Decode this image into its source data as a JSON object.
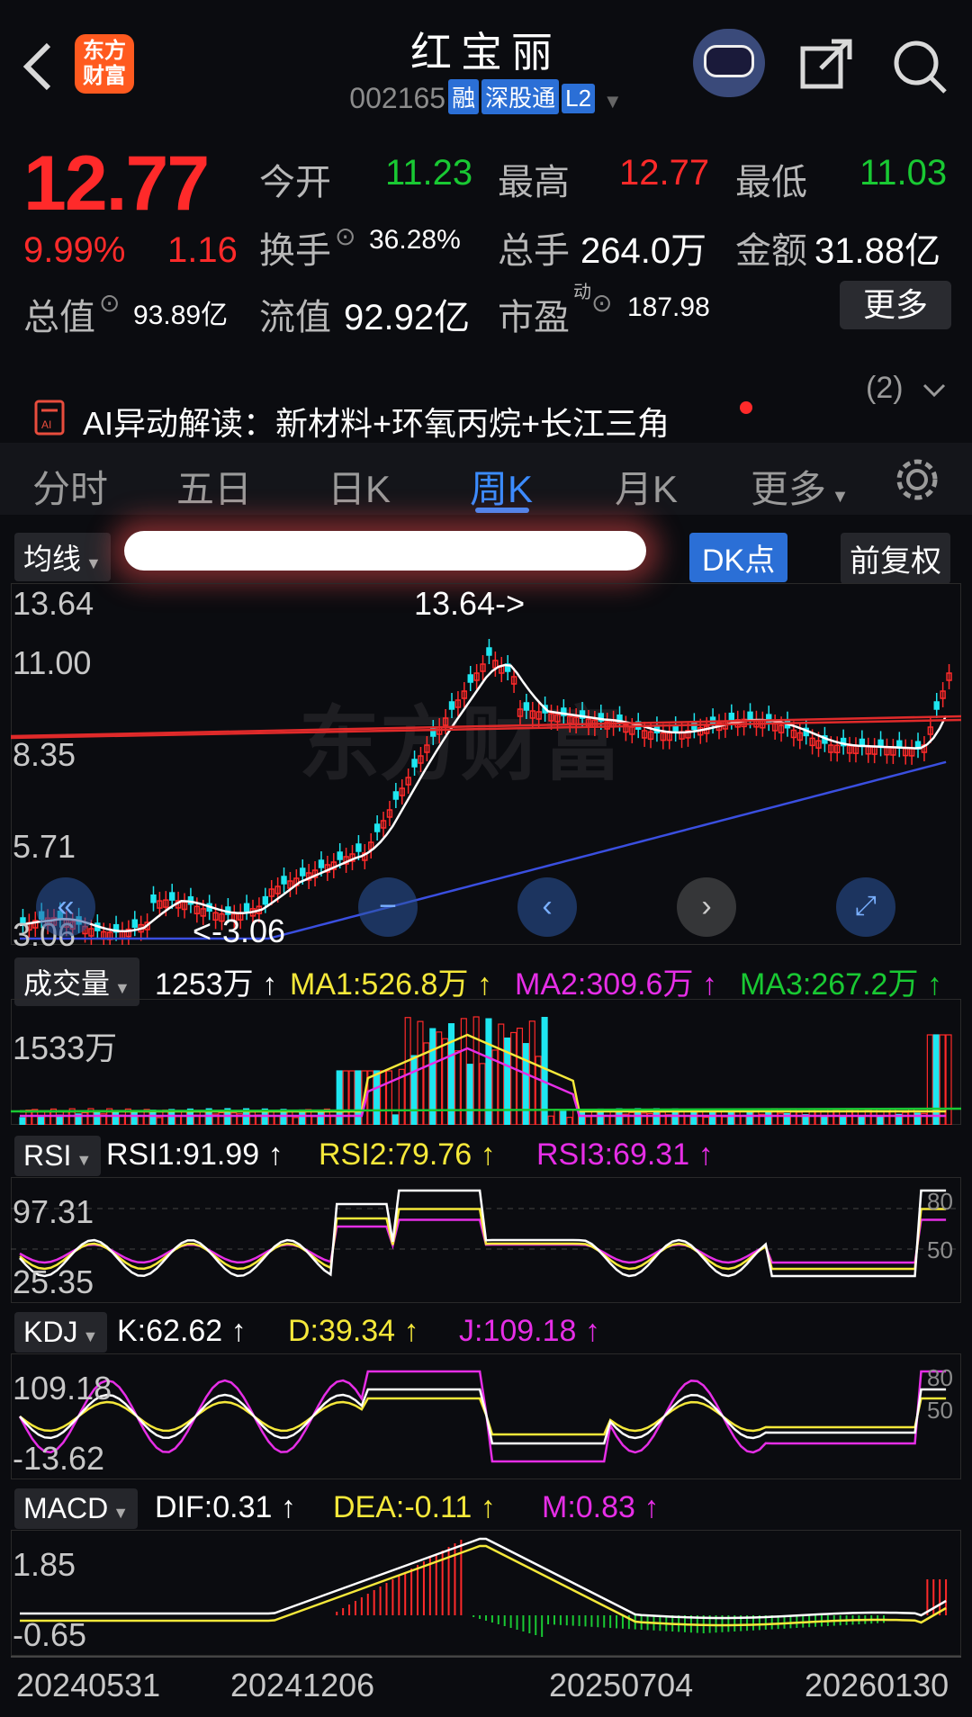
{
  "header": {
    "title": "红宝丽",
    "code": "002165",
    "tags": [
      "融",
      "深股通",
      "L2"
    ],
    "logo_lines": [
      "东方",
      "财富"
    ]
  },
  "quote": {
    "price": "12.77",
    "pct": "9.99%",
    "change": "1.16",
    "stats": {
      "open_label": "今开",
      "open": "11.23",
      "high_label": "最高",
      "high": "12.77",
      "low_label": "最低",
      "low": "11.03",
      "turnover_label": "换手",
      "turnover": "36.28%",
      "volume_label": "总手",
      "volume": "264.0万",
      "amount_label": "金额",
      "amount": "31.88亿",
      "mcap_label": "总值",
      "mcap": "93.89亿",
      "float_label": "流值",
      "float": "92.92亿",
      "pe_label": "市盈",
      "pe_sup": "动",
      "pe": "187.98"
    },
    "more_button": "更多"
  },
  "ai": {
    "text": "AI异动解读：新材料+环氧丙烷+长江三角",
    "count": "(2)"
  },
  "tabs": [
    "分时",
    "五日",
    "日K",
    "周K",
    "月K",
    "更多"
  ],
  "toolbar": {
    "ma_label": "均线",
    "dk_label": "DK点",
    "adjust_label": "前复权"
  },
  "kline": {
    "y_labels": [
      "13.64",
      "11.00",
      "8.35",
      "5.71",
      "3.06"
    ],
    "max_marker": "13.64->",
    "min_marker": "<-3.06",
    "watermark": "东方财富"
  },
  "volume": {
    "chip": "成交量",
    "current": "1253万 ↑",
    "ma1": "MA1:526.8万 ↑",
    "ma2": "MA2:309.6万 ↑",
    "ma3": "MA3:267.2万 ↑",
    "y_label": "1533万"
  },
  "rsi": {
    "chip": "RSI",
    "rsi1": "RSI1:91.99 ↑",
    "rsi2": "RSI2:79.76 ↑",
    "rsi3": "RSI3:69.31 ↑",
    "y_top": "97.31",
    "y_bottom": "25.35",
    "r80": "80",
    "r50": "50"
  },
  "kdj": {
    "chip": "KDJ",
    "k": "K:62.62 ↑",
    "d": "D:39.34 ↑",
    "j": "J:109.18 ↑",
    "y_top": "109.18",
    "y_bottom": "-13.62",
    "r80": "80",
    "r50": "50"
  },
  "macd": {
    "chip": "MACD",
    "dif": "DIF:0.31 ↑",
    "dea": "DEA:-0.11 ↑",
    "m": "M:0.83 ↑",
    "y_top": "1.85",
    "y_bottom": "-0.65"
  },
  "dates": [
    "20240531",
    "20241206",
    "20250704",
    "20260130"
  ],
  "colors": {
    "up": "#ff2a2a",
    "down": "#19c933",
    "accent": "#3b8cff",
    "yellow": "#f5e83a",
    "magenta": "#e62ee6",
    "cyan": "#1ee6f0"
  }
}
